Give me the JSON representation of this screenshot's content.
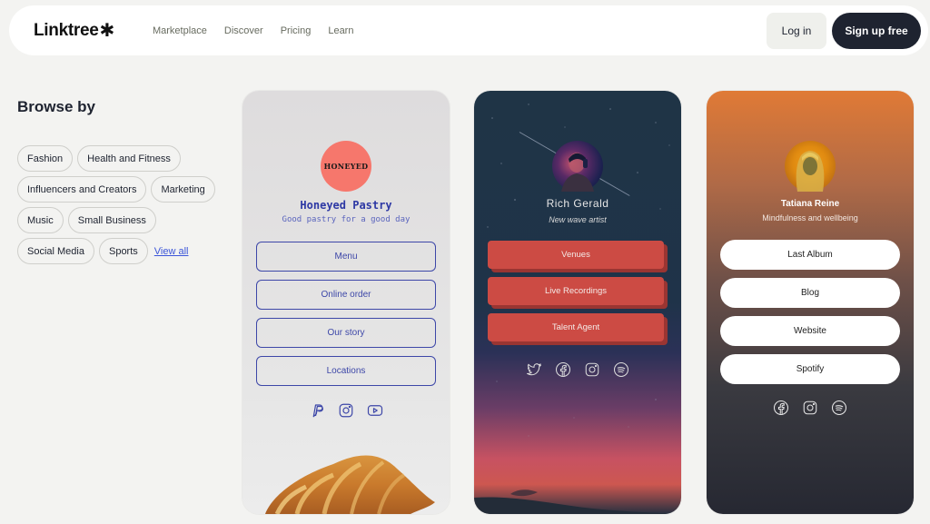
{
  "nav": {
    "logo": "Linktree",
    "logo_mark": "✱",
    "links": [
      "Marketplace",
      "Discover",
      "Pricing",
      "Learn"
    ],
    "login_label": "Log in",
    "signup_label": "Sign up free"
  },
  "browse": {
    "title": "Browse by",
    "categories": [
      "Fashion",
      "Health and Fitness",
      "Influencers and Creators",
      "Marketing",
      "Music",
      "Small Business",
      "Social Media",
      "Sports"
    ],
    "view_all": "View all"
  },
  "cards": [
    {
      "logo_text": "HONEYED",
      "name": "Honeyed Pastry",
      "bio": "Good pastry for a good day",
      "links": [
        "Menu",
        "Online order",
        "Our story",
        "Locations"
      ],
      "socials": [
        "paypal-icon",
        "instagram-icon",
        "youtube-icon"
      ],
      "accent": "#3d47a8"
    },
    {
      "name": "Rich Gerald",
      "bio": "New wave artist",
      "links": [
        "Venues",
        "Live Recordings",
        "Talent Agent"
      ],
      "socials": [
        "twitter-icon",
        "facebook-icon",
        "instagram-icon",
        "spotify-icon"
      ],
      "accent": "#cc4b44"
    },
    {
      "name": "Tatiana Reine",
      "bio": "Mindfulness and wellbeing",
      "links": [
        "Last Album",
        "Blog",
        "Website",
        "Spotify"
      ],
      "socials": [
        "facebook-icon",
        "instagram-icon",
        "spotify-icon"
      ],
      "accent": "#e07a36"
    }
  ]
}
